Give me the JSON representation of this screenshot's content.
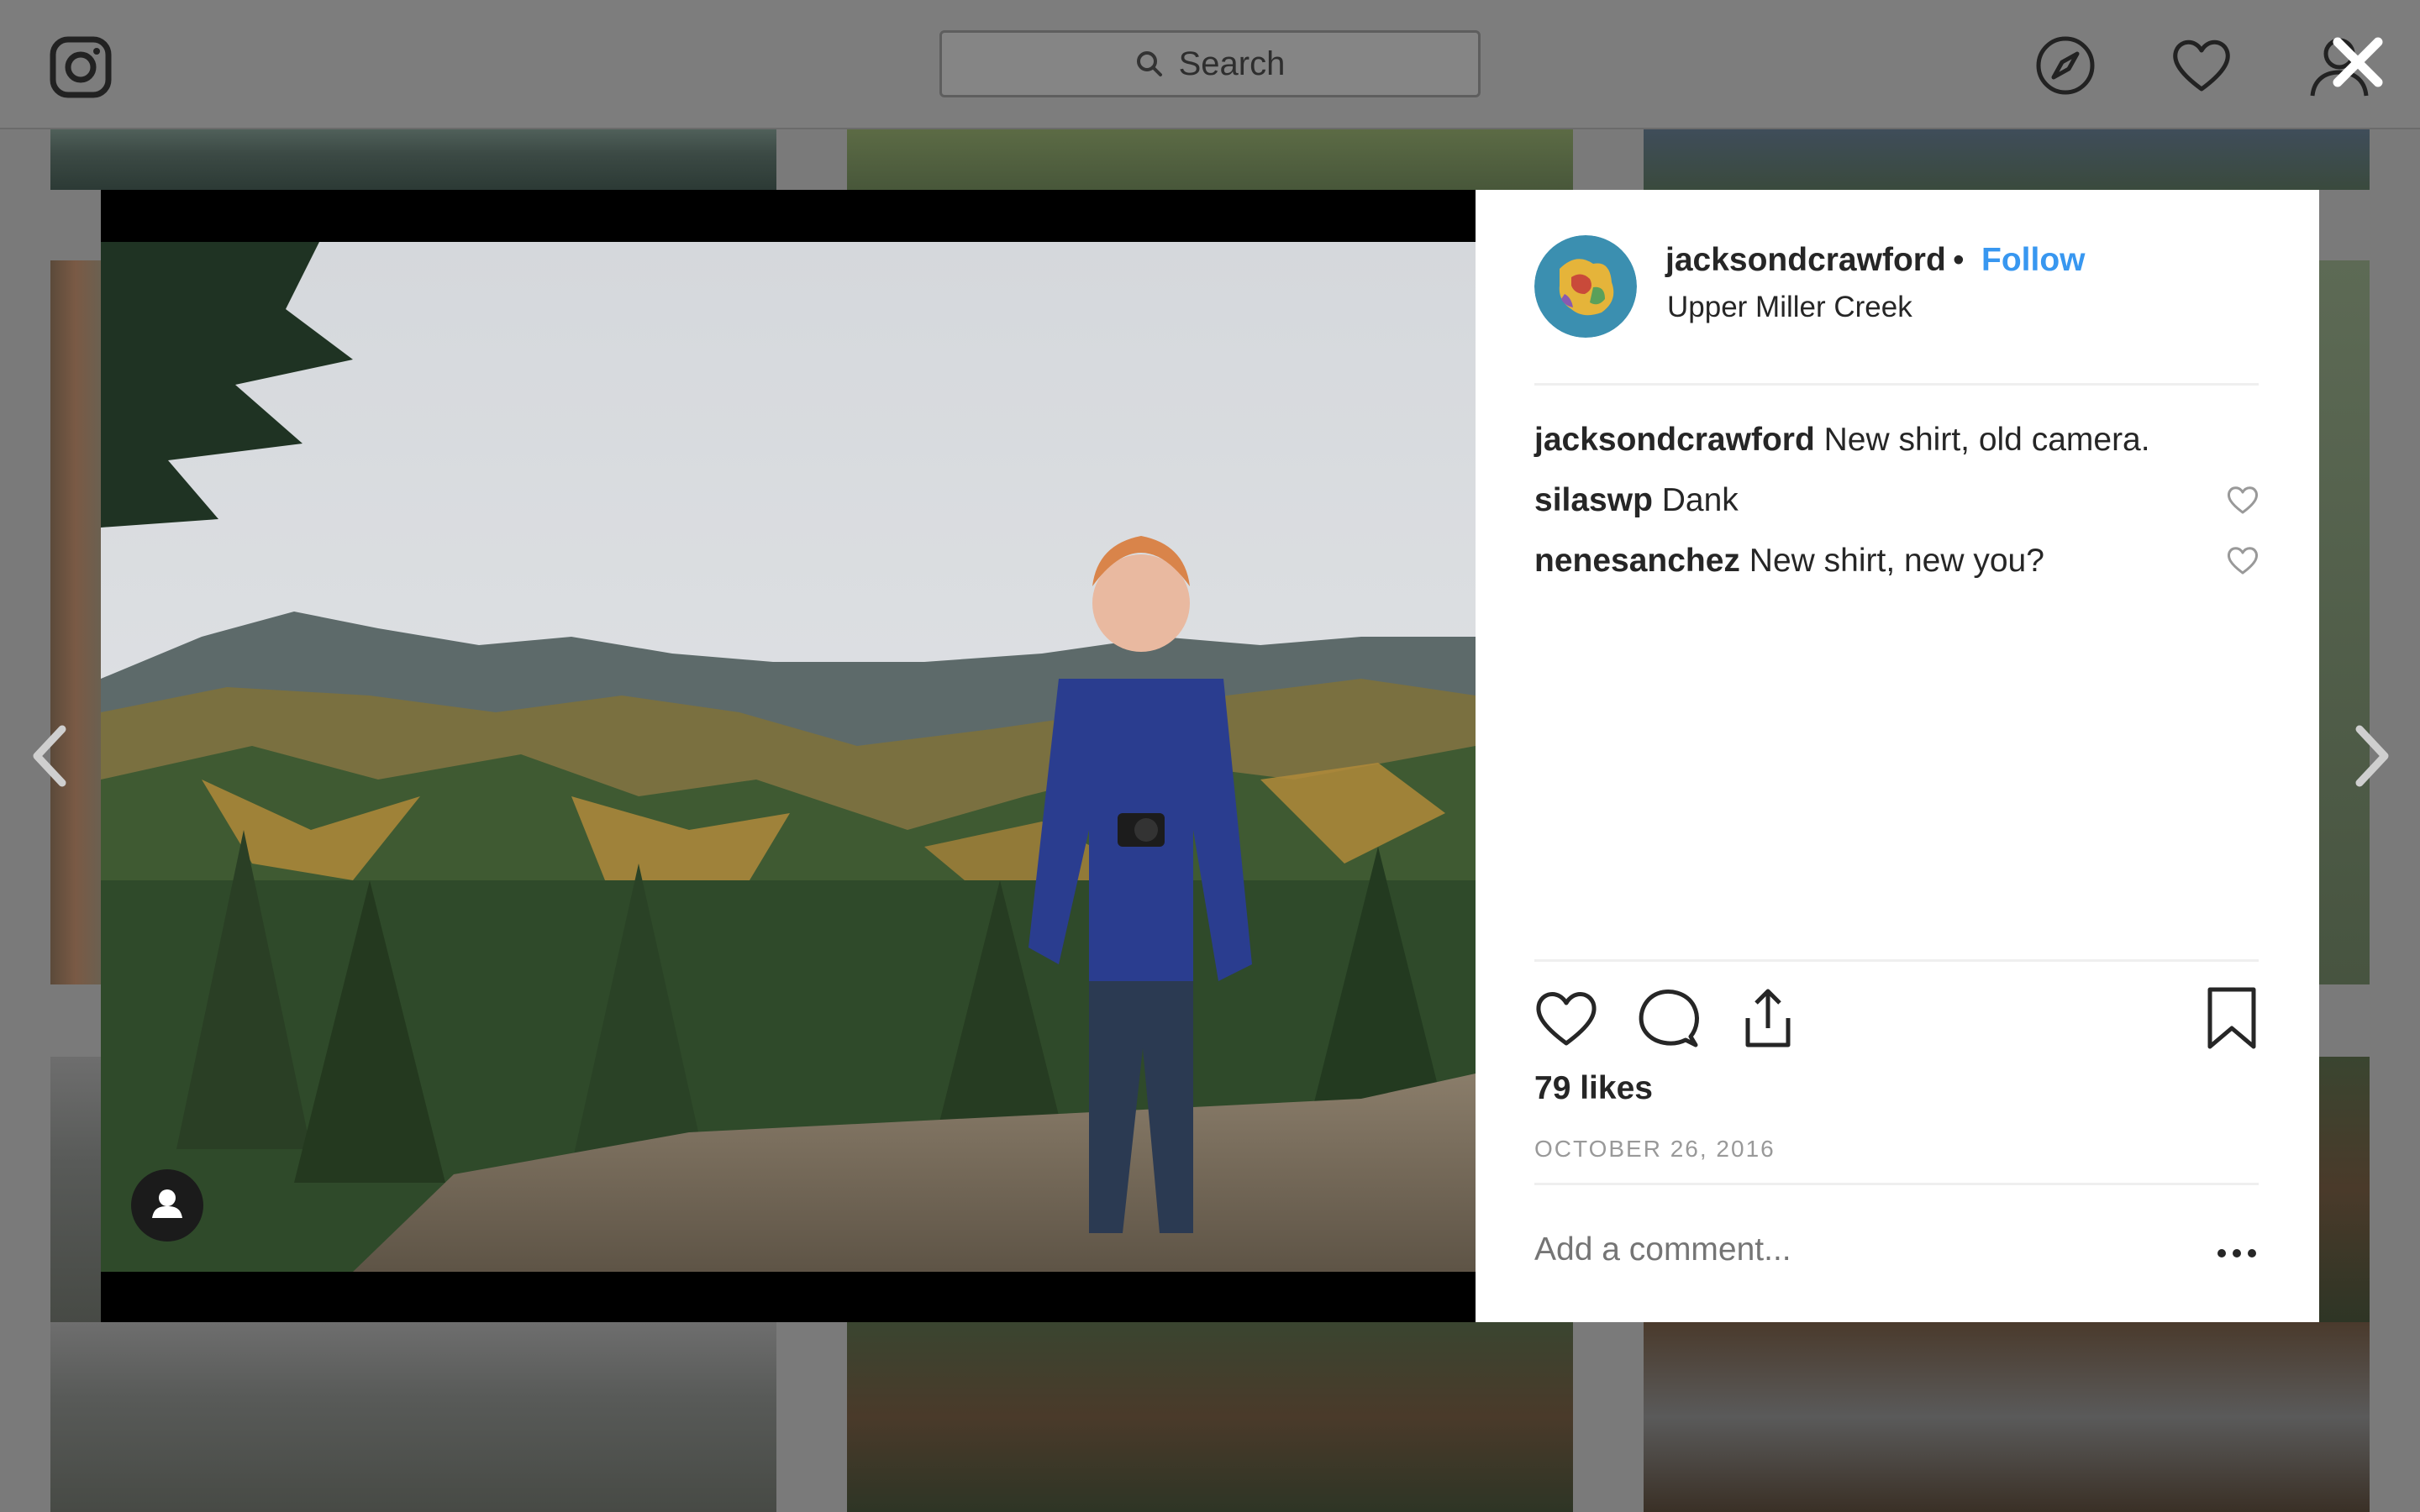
{
  "topbar": {
    "search_placeholder": "Search",
    "icons": [
      "instagram-logo",
      "compass-icon",
      "heart-icon",
      "profile-icon"
    ],
    "close_icon": "close-icon"
  },
  "post": {
    "username": "jacksondcrawford",
    "separator": "•",
    "follow_label": "Follow",
    "location": "Upper Miller Creek",
    "comments": [
      {
        "user": "jacksondcrawford",
        "text": "New shirt, old camera."
      },
      {
        "user": "silaswp",
        "text": "Dank"
      },
      {
        "user": "nenesanchez",
        "text": "New shirt, new you?"
      }
    ],
    "likes": "79 likes",
    "date": "OCTOBER 26, 2016",
    "add_comment_placeholder": "Add a comment..."
  },
  "colors": {
    "follow_blue": "#3897f0",
    "text": "#262626",
    "muted": "#999999",
    "overlay": "#7a7a7a"
  }
}
